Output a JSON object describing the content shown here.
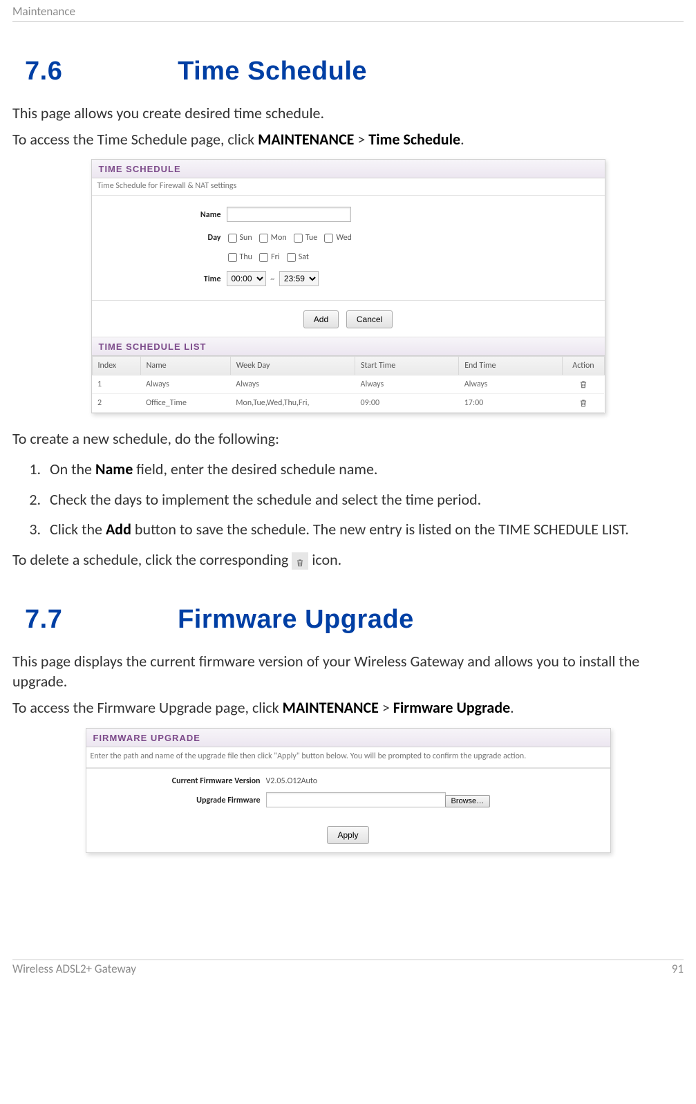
{
  "header": {
    "running": "Maintenance"
  },
  "s76": {
    "num": "7.6",
    "title": "Time Schedule",
    "intro": "This page allows you create desired time schedule.",
    "access_pre": "To access the Time Schedule page, click ",
    "access_b1": "MAINTENANCE",
    "access_mid": " > ",
    "access_b2": "Time Schedule",
    "access_post": "."
  },
  "ts": {
    "title": "TIME SCHEDULE",
    "desc": "Time Schedule for Firewall & NAT settings",
    "labels": {
      "name": "Name",
      "day": "Day",
      "time": "Time"
    },
    "days": {
      "sun": "Sun",
      "mon": "Mon",
      "tue": "Tue",
      "wed": "Wed",
      "thu": "Thu",
      "fri": "Fri",
      "sat": "Sat"
    },
    "time_start": "00:00",
    "time_sep": "~",
    "time_end": "23:59",
    "buttons": {
      "add": "Add",
      "cancel": "Cancel"
    },
    "list_title": "TIME SCHEDULE LIST",
    "cols": {
      "index": "Index",
      "name": "Name",
      "weekday": "Week Day",
      "start": "Start Time",
      "end": "End Time",
      "action": "Action"
    },
    "rows": [
      {
        "index": "1",
        "name": "Always",
        "weekday": "Always",
        "start": "Always",
        "end": "Always"
      },
      {
        "index": "2",
        "name": "Office_Time",
        "weekday": "Mon,Tue,Wed,Thu,Fri,",
        "start": "09:00",
        "end": "17:00"
      }
    ]
  },
  "steps": {
    "intro": "To create a new schedule, do the following:",
    "s1_pre": "On the ",
    "s1_b": "Name",
    "s1_post": " field, enter the desired schedule name.",
    "s2": "Check the days to implement the schedule and select the time period.",
    "s3_pre": "Click the ",
    "s3_b": "Add",
    "s3_post": " button to save the schedule. The new entry is listed on the TIME SCHEDULE LIST.",
    "delete_pre": "To delete a schedule, click the corresponding ",
    "delete_post": " icon."
  },
  "s77": {
    "num": "7.7",
    "title": "Firmware Upgrade",
    "intro": "This page displays the current firmware version of your Wireless Gateway and allows you to install the upgrade.",
    "access_pre": "To access the Firmware Upgrade page, click ",
    "access_b1": "MAINTENANCE",
    "access_mid": " > ",
    "access_b2": "Firmware Upgrade",
    "access_post": "."
  },
  "fw": {
    "title": "FIRMWARE UPGRADE",
    "desc": "Enter the path and name of the upgrade file then click \"Apply\" button below. You will be prompted to confirm the upgrade action.",
    "labels": {
      "current": "Current Firmware Version",
      "upgrade": "Upgrade Firmware"
    },
    "version": "V2.05.O12Auto",
    "browse": "Browse…",
    "apply": "Apply"
  },
  "footer": {
    "product": "Wireless ADSL2+ Gateway",
    "page": "91"
  }
}
